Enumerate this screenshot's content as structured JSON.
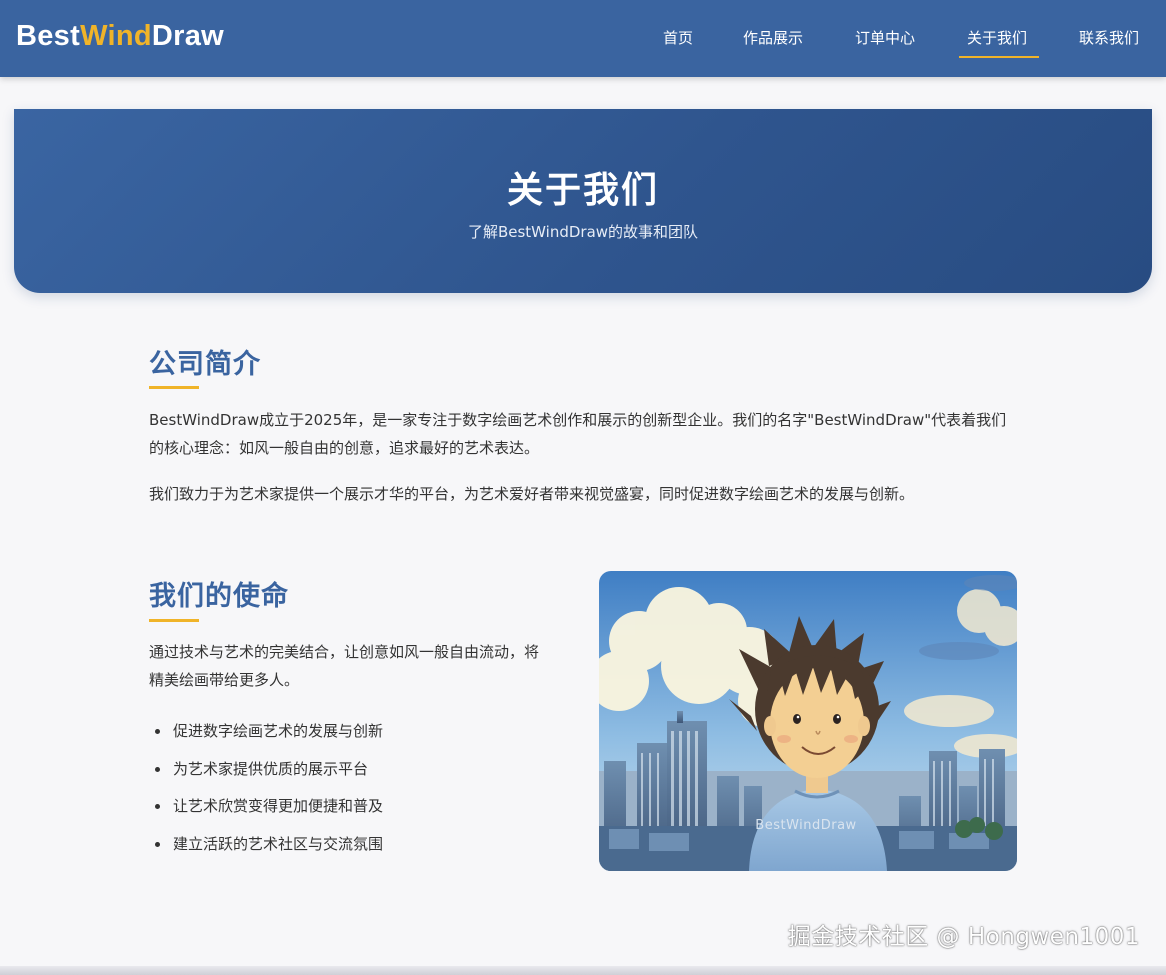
{
  "header": {
    "logo_part1": "Best",
    "logo_part2": "Wind",
    "logo_part3": "Draw",
    "nav": [
      {
        "label": "首页"
      },
      {
        "label": "作品展示"
      },
      {
        "label": "订单中心"
      },
      {
        "label": "关于我们",
        "active": true
      },
      {
        "label": "联系我们"
      }
    ]
  },
  "hero": {
    "title": "关于我们",
    "subtitle": "了解BestWindDraw的故事和团队"
  },
  "intro": {
    "title": "公司简介",
    "paragraph1": "BestWindDraw成立于2025年，是一家专注于数字绘画艺术创作和展示的创新型企业。我们的名字\"BestWindDraw\"代表着我们的核心理念：如风一般自由的创意，追求最好的艺术表达。",
    "paragraph2": "我们致力于为艺术家提供一个展示才华的平台，为艺术爱好者带来视觉盛宴，同时促进数字绘画艺术的发展与创新。"
  },
  "mission": {
    "title": "我们的使命",
    "description": "通过技术与艺术的完美结合，让创意如风一般自由流动，将精美绘画带给更多人。",
    "points": [
      "促进数字绘画艺术的发展与创新",
      "为艺术家提供优质的展示平台",
      "让艺术欣赏变得更加便捷和普及",
      "建立活跃的艺术社区与交流氛围"
    ],
    "image_shirt_text": "BestWindDraw"
  },
  "watermark": "掘金技术社区 @ Hongwen1001",
  "colors": {
    "primary": "#3a64a0",
    "accent": "#f0b429",
    "background": "#f7f7f9"
  }
}
